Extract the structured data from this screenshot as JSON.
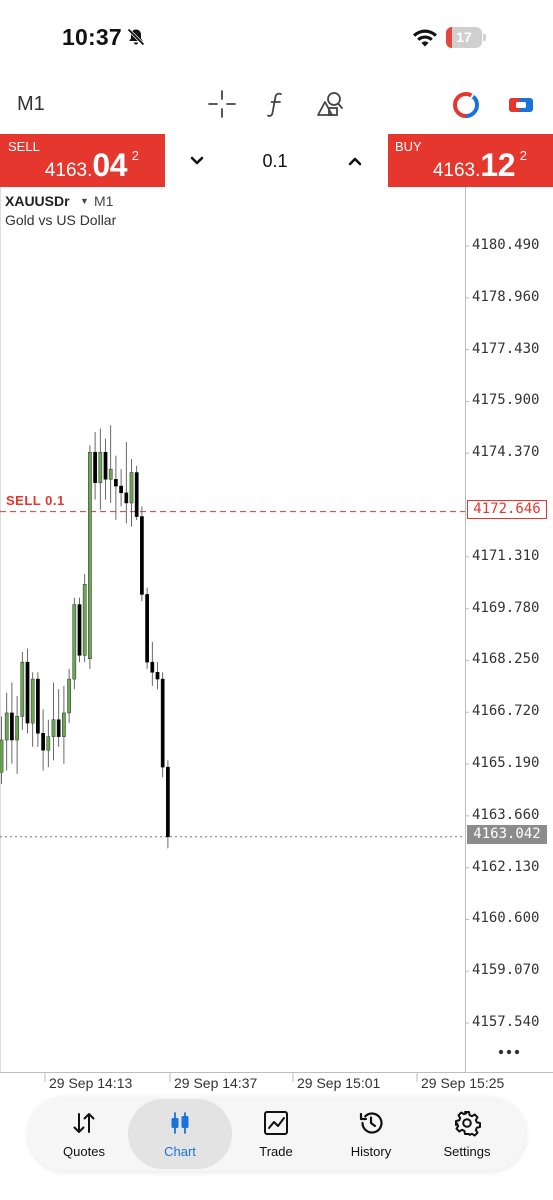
{
  "status_bar": {
    "time": "10:37",
    "battery_level": "17",
    "battery_fraction": 0.17,
    "icons": [
      "bell-slash-icon",
      "wifi-icon",
      "battery-icon"
    ]
  },
  "toolbar": {
    "timeframe": "M1",
    "icons": [
      "crosshair-icon",
      "function-icon",
      "objects-icon",
      "colors-icon",
      "switch-icon"
    ]
  },
  "trade_bar": {
    "sell_label": "SELL",
    "sell_price_small": "4163.",
    "sell_price_big": "04",
    "sell_price_sup": "2",
    "buy_label": "BUY",
    "buy_price_small": "4163.",
    "buy_price_big": "12",
    "buy_price_sup": "2",
    "lot": "0.1",
    "sell_color": "#e5372d"
  },
  "chart": {
    "symbol": "XAUUSDr",
    "timeframe": "M1",
    "description": "Gold vs US Dollar",
    "sell_line_label": "SELL 0.1",
    "sell_line_price": "4172.646",
    "bid_price": "4163.042",
    "bull_color": "#6aa84f",
    "bear_color": "#000000"
  },
  "chart_data": {
    "type": "candlestick",
    "y_ticks": [
      "4180.490",
      "4178.960",
      "4177.430",
      "4175.900",
      "4174.370",
      "4171.310",
      "4169.780",
      "4168.250",
      "4166.720",
      "4165.190",
      "4163.660",
      "4162.130",
      "4160.600",
      "4159.070",
      "4157.540"
    ],
    "x_ticks": [
      "29 Sep 14:13",
      "29 Sep 14:37",
      "29 Sep 15:01",
      "29 Sep 15:25"
    ],
    "ylim": [
      4156.5,
      4181.6
    ],
    "horizontal_lines": [
      {
        "price": 4172.646,
        "color": "#e5372d",
        "style": "dashed"
      },
      {
        "price": 4163.042,
        "color": "#777777",
        "style": "dotted"
      }
    ],
    "candles": [
      {
        "o": 4164.95,
        "h": 4166.6,
        "l": 4164.6,
        "c": 4165.9
      },
      {
        "o": 4165.9,
        "h": 4167.3,
        "l": 4165.0,
        "c": 4166.7
      },
      {
        "o": 4166.7,
        "h": 4167.6,
        "l": 4165.2,
        "c": 4165.9
      },
      {
        "o": 4165.9,
        "h": 4167.2,
        "l": 4164.9,
        "c": 4166.6
      },
      {
        "o": 4166.6,
        "h": 4168.5,
        "l": 4166.2,
        "c": 4168.2
      },
      {
        "o": 4168.2,
        "h": 4168.6,
        "l": 4166.1,
        "c": 4166.4
      },
      {
        "o": 4166.4,
        "h": 4167.9,
        "l": 4165.7,
        "c": 4167.7
      },
      {
        "o": 4167.7,
        "h": 4167.9,
        "l": 4165.7,
        "c": 4166.1
      },
      {
        "o": 4166.1,
        "h": 4166.8,
        "l": 4165.0,
        "c": 4165.6
      },
      {
        "o": 4165.6,
        "h": 4166.5,
        "l": 4165.1,
        "c": 4166.0
      },
      {
        "o": 4166.0,
        "h": 4167.6,
        "l": 4165.3,
        "c": 4166.5
      },
      {
        "o": 4166.5,
        "h": 4167.4,
        "l": 4165.7,
        "c": 4166.0
      },
      {
        "o": 4166.0,
        "h": 4167.5,
        "l": 4165.2,
        "c": 4166.7
      },
      {
        "o": 4166.7,
        "h": 4168.0,
        "l": 4166.4,
        "c": 4167.7
      },
      {
        "o": 4167.7,
        "h": 4170.1,
        "l": 4167.4,
        "c": 4169.9
      },
      {
        "o": 4169.9,
        "h": 4170.1,
        "l": 4168.2,
        "c": 4168.4
      },
      {
        "o": 4168.4,
        "h": 4170.8,
        "l": 4168.2,
        "c": 4170.5
      },
      {
        "o": 4168.3,
        "h": 4174.6,
        "l": 4168.0,
        "c": 4174.4
      },
      {
        "o": 4174.4,
        "h": 4175.0,
        "l": 4173.0,
        "c": 4173.5
      },
      {
        "o": 4173.5,
        "h": 4175.1,
        "l": 4172.7,
        "c": 4174.4
      },
      {
        "o": 4174.4,
        "h": 4174.8,
        "l": 4173.0,
        "c": 4173.6
      },
      {
        "o": 4173.6,
        "h": 4175.2,
        "l": 4172.9,
        "c": 4173.9
      },
      {
        "o": 4173.6,
        "h": 4174.3,
        "l": 4172.4,
        "c": 4173.4
      },
      {
        "o": 4173.4,
        "h": 4173.9,
        "l": 4172.8,
        "c": 4173.2
      },
      {
        "o": 4173.2,
        "h": 4174.7,
        "l": 4172.3,
        "c": 4172.9
      },
      {
        "o": 4172.9,
        "h": 4174.2,
        "l": 4172.2,
        "c": 4173.8
      },
      {
        "o": 4173.8,
        "h": 4174.0,
        "l": 4172.4,
        "c": 4172.5
      },
      {
        "o": 4172.5,
        "h": 4172.8,
        "l": 4170.0,
        "c": 4170.2
      },
      {
        "o": 4170.2,
        "h": 4170.4,
        "l": 4168.0,
        "c": 4168.2
      },
      {
        "o": 4168.2,
        "h": 4168.8,
        "l": 4167.5,
        "c": 4167.9
      },
      {
        "o": 4167.9,
        "h": 4168.2,
        "l": 4167.4,
        "c": 4167.7
      },
      {
        "o": 4167.7,
        "h": 4167.9,
        "l": 4164.8,
        "c": 4165.1
      },
      {
        "o": 4165.1,
        "h": 4165.3,
        "l": 4162.7,
        "c": 4163.04
      }
    ]
  },
  "bottom_nav": {
    "items": [
      {
        "label": "Quotes",
        "icon": "arrows-icon",
        "active": false
      },
      {
        "label": "Chart",
        "icon": "candles-icon",
        "active": true
      },
      {
        "label": "Trade",
        "icon": "trade-chart-icon",
        "active": false
      },
      {
        "label": "History",
        "icon": "history-icon",
        "active": false
      },
      {
        "label": "Settings",
        "icon": "settings-icon",
        "active": false
      }
    ],
    "active_color": "#1a73d9"
  }
}
